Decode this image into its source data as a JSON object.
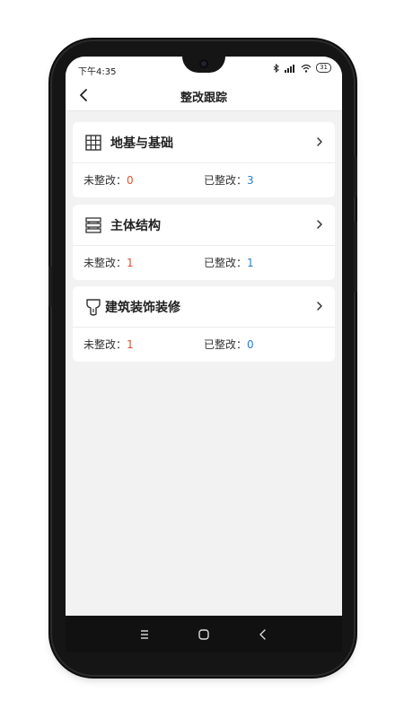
{
  "statusbar": {
    "time": "下午4:35",
    "battery": "31"
  },
  "header": {
    "title": "整改跟踪"
  },
  "labels": {
    "pending": "未整改：",
    "done": "已整改："
  },
  "categories": [
    {
      "name": "地基与基础",
      "icon": "grid-icon",
      "pending": "0",
      "done": "3"
    },
    {
      "name": "主体结构",
      "icon": "structure-icon",
      "pending": "1",
      "done": "1"
    },
    {
      "name": "建筑装饰装修",
      "icon": "paint-brush-icon",
      "pending": "1",
      "done": "0"
    }
  ],
  "colors": {
    "pending_value": "#e5502f",
    "done_value": "#2a7fcf"
  },
  "system_nav": [
    "menu-icon",
    "home-icon",
    "back-icon"
  ]
}
